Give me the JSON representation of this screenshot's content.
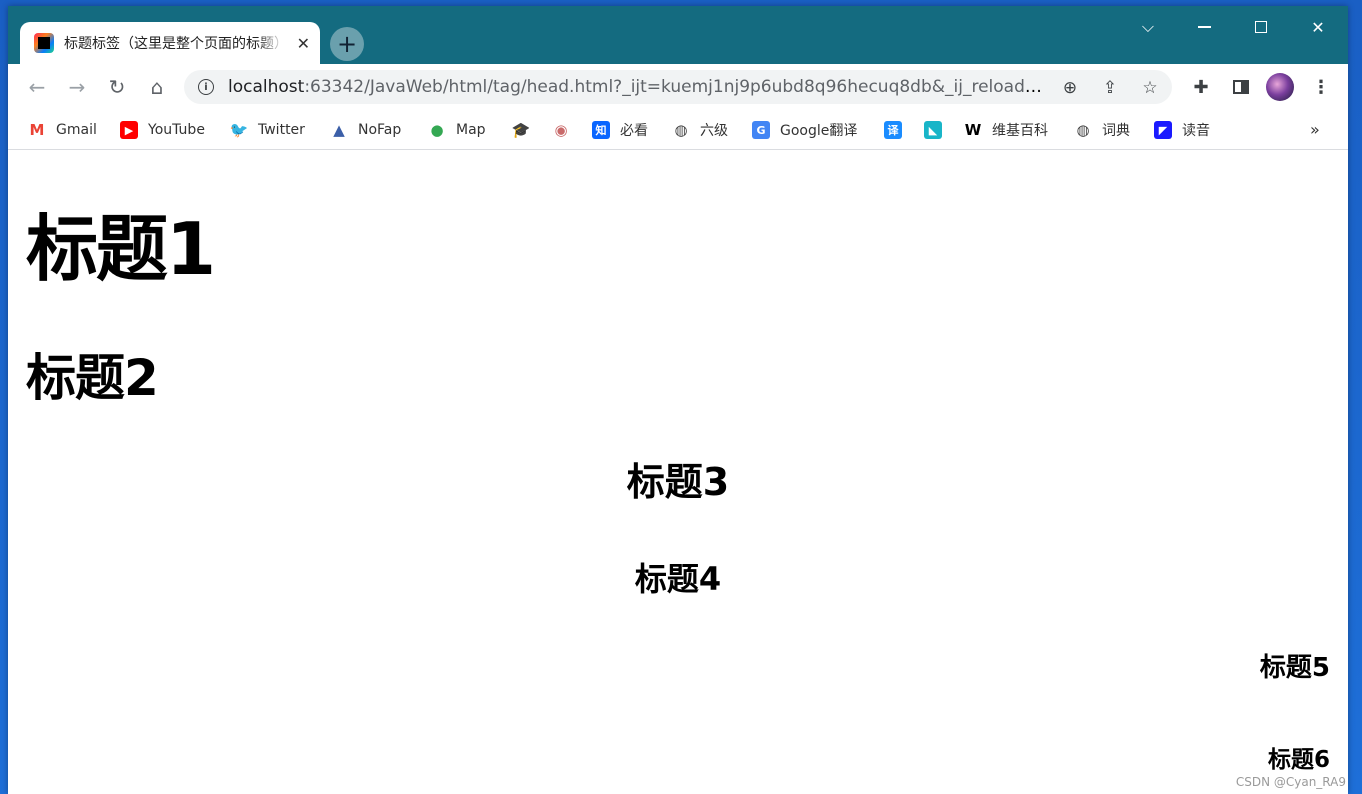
{
  "browser": {
    "tab_title": "标题标签（这里是整个页面的标题）",
    "tab_close": "✕",
    "new_tab": "+",
    "controls": {
      "dropdown": "⌵",
      "close": "✕"
    },
    "url_host": "localhost",
    "url_rest": ":63342/JavaWeb/html/tag/head.html?_ijt=kuemj1nj9p6ubd8q96hecuq8db&_ij_reload=..."
  },
  "bookmarks": [
    {
      "label": "Gmail",
      "icon": "gmail-icon",
      "glyph": "M",
      "color": "#ea4335"
    },
    {
      "label": "YouTube",
      "icon": "youtube-icon",
      "glyph": "▶",
      "color": "#ff0000"
    },
    {
      "label": "Twitter",
      "icon": "twitter-icon",
      "glyph": "🐦",
      "color": "#1da1f2"
    },
    {
      "label": "NoFap",
      "icon": "nofap-icon",
      "glyph": "▲",
      "color": "#3b5fa8"
    },
    {
      "label": "Map",
      "icon": "map-pin-icon",
      "glyph": "●",
      "color": "#34a853"
    },
    {
      "label": "",
      "icon": "graduation-cap-icon",
      "glyph": "🎓",
      "color": "#333333"
    },
    {
      "label": "",
      "icon": "seal-icon",
      "glyph": "◉",
      "color": "#c96a6a"
    },
    {
      "label": "必看",
      "icon": "zhihu-icon",
      "glyph": "知",
      "color": "#0a66ff"
    },
    {
      "label": "六级",
      "icon": "globe-icon",
      "glyph": "◍",
      "color": "#444444"
    },
    {
      "label": "Google翻译",
      "icon": "google-translate-icon",
      "glyph": "G",
      "color": "#4285f4"
    },
    {
      "label": "",
      "icon": "translate-icon",
      "glyph": "译",
      "color": "#1a8cff"
    },
    {
      "label": "",
      "icon": "bookmark-app-icon",
      "glyph": "◣",
      "color": "#19b5c8"
    },
    {
      "label": "维基百科",
      "icon": "wikipedia-icon",
      "glyph": "W",
      "color": "#000000"
    },
    {
      "label": "词典",
      "icon": "globe-icon",
      "glyph": "◍",
      "color": "#444444"
    },
    {
      "label": "读音",
      "icon": "reading-icon",
      "glyph": "◤",
      "color": "#1a1aff"
    }
  ],
  "bookmarks_more": "»",
  "page": {
    "h1": "标题1",
    "h2": "标题2",
    "h3": "标题3",
    "h4": "标题4",
    "h5": "标题5",
    "h6": "标题6"
  },
  "watermark": "CSDN @Cyan_RA9"
}
